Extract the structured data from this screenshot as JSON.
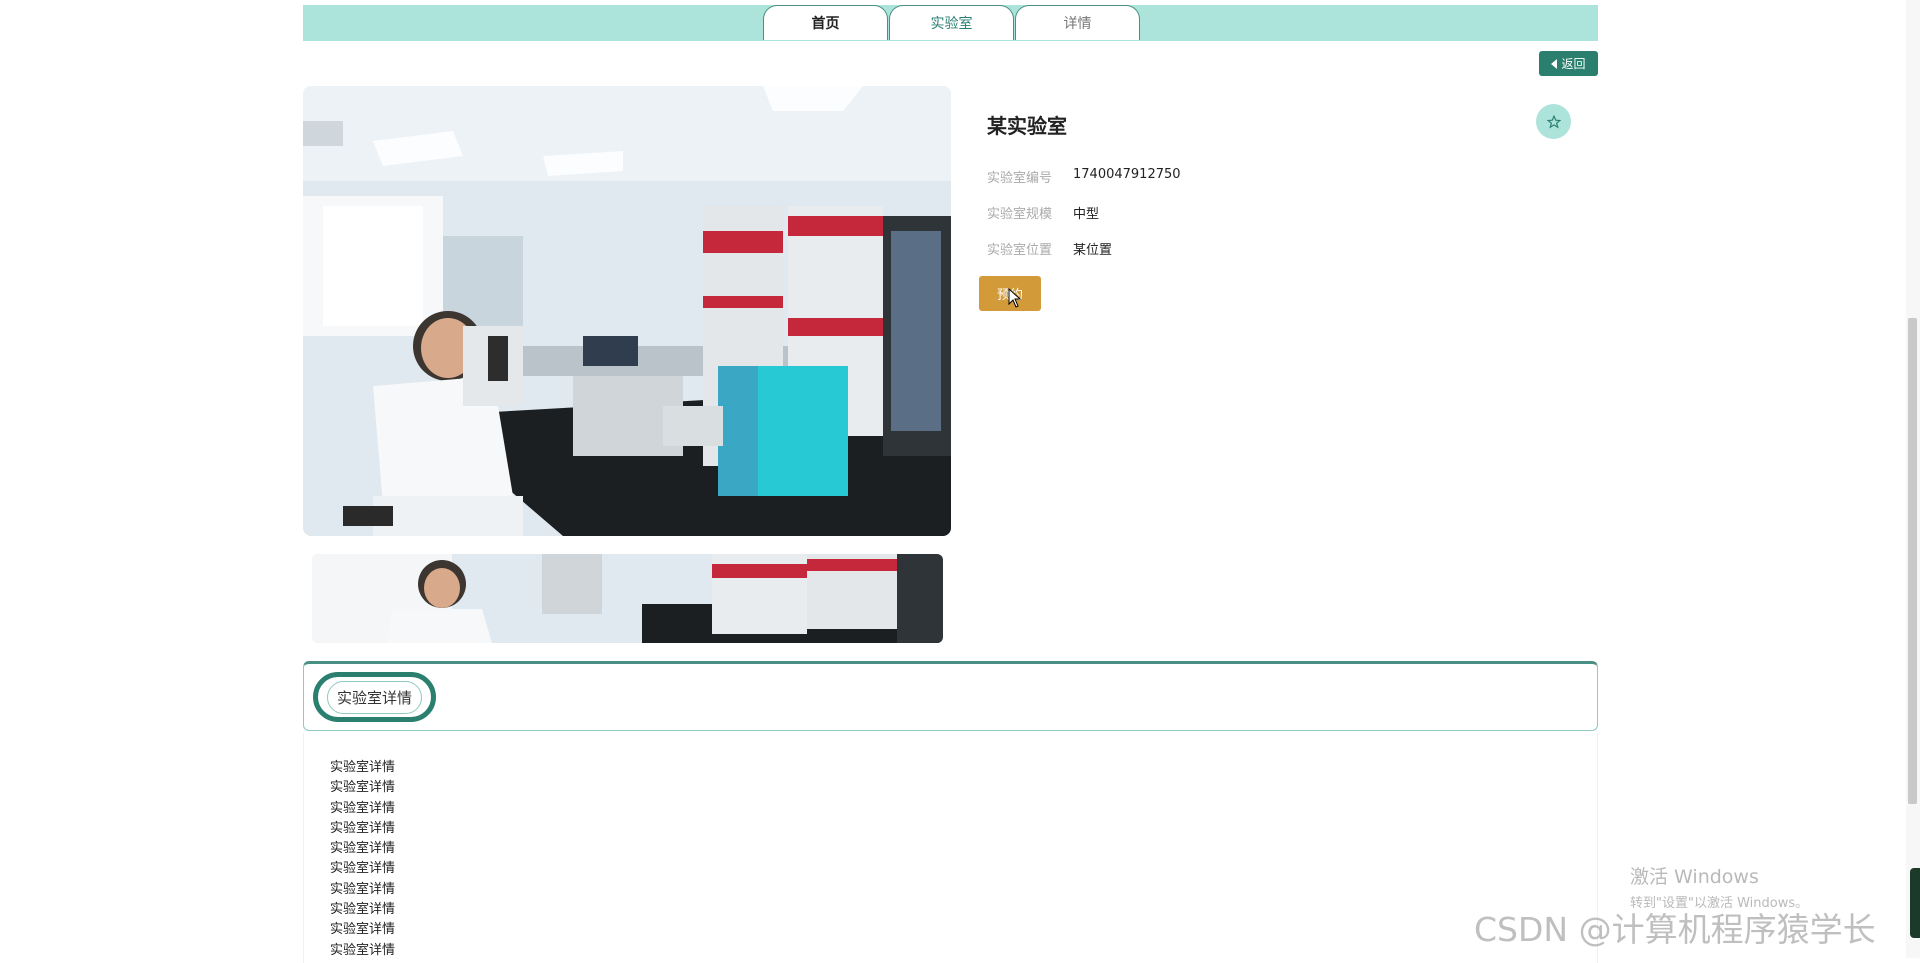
{
  "nav": {
    "tabs": [
      {
        "label": "首页"
      },
      {
        "label": "实验室"
      },
      {
        "label": "详情"
      }
    ],
    "back_label": "返回"
  },
  "lab": {
    "name": "某实验室",
    "fields": [
      {
        "label": "实验室编号",
        "value": "1740047912750"
      },
      {
        "label": "实验室规模",
        "value": "中型"
      },
      {
        "label": "实验室位置",
        "value": "某位置"
      }
    ],
    "reserve_label": "预约"
  },
  "detail": {
    "tab_label": "实验室详情",
    "lines": [
      "实验室详情",
      "实验室详情",
      "实验室详情",
      "实验室详情",
      "实验室详情",
      "实验室详情",
      "实验室详情",
      "实验室详情",
      "实验室详情",
      "实验室详情"
    ]
  },
  "overlay": {
    "activate_title": "激活 Windows",
    "activate_hint": "转到\"设置\"以激活 Windows。",
    "watermark": "CSDN @计算机程序猿学长"
  },
  "colors": {
    "accent": "#2a7f6f",
    "nav_bg": "#ace3da",
    "reserve": "#d39a3a"
  },
  "icons": {
    "back": "caret-left-icon",
    "favorite": "star-outline-icon"
  }
}
